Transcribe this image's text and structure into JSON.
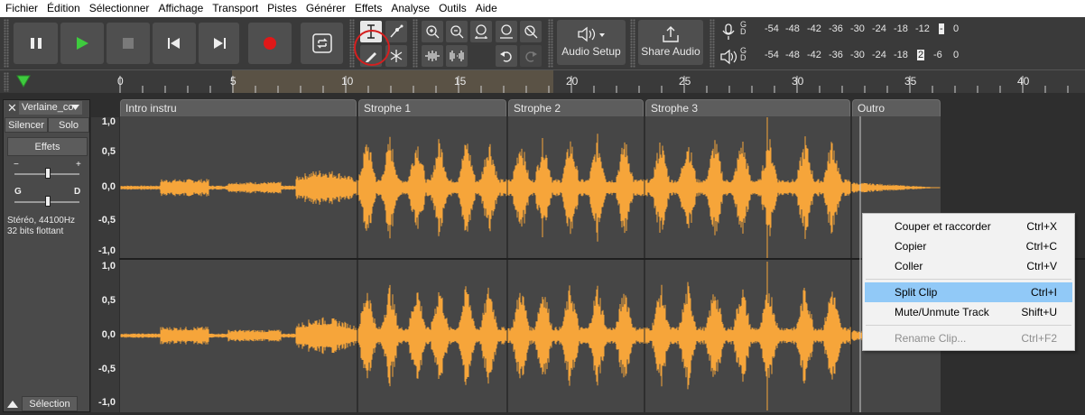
{
  "menu": [
    "Fichier",
    "Édition",
    "Sélectionner",
    "Affichage",
    "Transport",
    "Pistes",
    "Générer",
    "Effets",
    "Analyse",
    "Outils",
    "Aide"
  ],
  "toolbar": {
    "audio_setup_label": "Audio Setup",
    "share_audio_label": "Share Audio",
    "record_color": "#e01818",
    "play_color": "#3ecb3e"
  },
  "meters": {
    "record_channels": [
      "G",
      "D"
    ],
    "playback_channels": [
      "G",
      "D"
    ],
    "record_ticks": [
      "-54",
      "-48",
      "-42",
      "-36",
      "-30",
      "-24",
      "-18",
      "-12",
      "-",
      "0"
    ],
    "playback_ticks": [
      "-54",
      "-48",
      "-42",
      "-36",
      "-30",
      "-24",
      "-18",
      "2",
      "-6",
      "0"
    ]
  },
  "ruler": {
    "labels": [
      "0",
      "5",
      "10",
      "15",
      "20",
      "25",
      "30",
      "35",
      "40"
    ]
  },
  "track": {
    "name": "Verlaine_co",
    "mute_label": "Silencer",
    "solo_label": "Solo",
    "effects_label": "Effets",
    "gain_minus": "−",
    "gain_plus": "+",
    "pan_left": "G",
    "pan_right": "D",
    "info_line1": "Stéréo, 44100Hz",
    "info_line2": "32 bits flottant",
    "select_label": "Sélection"
  },
  "scale": {
    "top": [
      "1,0",
      "0,5",
      "0,0",
      "-0,5",
      "-1,0"
    ],
    "bottom": [
      "1,0",
      "0,5",
      "0,0",
      "-0,5",
      "-1,0"
    ]
  },
  "clips": [
    {
      "name": "Intro instru"
    },
    {
      "name": "Strophe 1"
    },
    {
      "name": "Strophe 2"
    },
    {
      "name": "Strophe 3"
    },
    {
      "name": "Outro"
    }
  ],
  "waveform_color": "#f6a53a",
  "context_menu": {
    "items": [
      {
        "label": "Couper et raccorder",
        "shortcut": "Ctrl+X"
      },
      {
        "label": "Copier",
        "shortcut": "Ctrl+C"
      },
      {
        "label": "Coller",
        "shortcut": "Ctrl+V"
      },
      {
        "label": "Split Clip",
        "shortcut": "Ctrl+I"
      },
      {
        "label": "Mute/Unmute Track",
        "shortcut": "Shift+U"
      },
      {
        "label": "Rename Clip...",
        "shortcut": "Ctrl+F2"
      }
    ]
  }
}
